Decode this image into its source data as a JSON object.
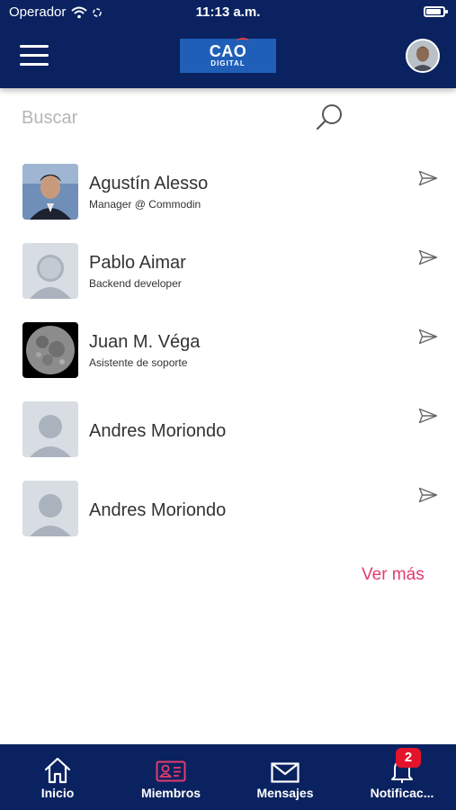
{
  "status_bar": {
    "carrier": "Operador",
    "time": "11:13 a.m.",
    "battery_level": 0.9
  },
  "header": {
    "logo_line1": "CAO",
    "logo_line2": "DIGITAL"
  },
  "search": {
    "placeholder": "Buscar"
  },
  "members": [
    {
      "name": "Agustín Alesso",
      "subtitle": "Manager @ Commodin",
      "avatar": "photo-man"
    },
    {
      "name": "Pablo Aimar",
      "subtitle": "Backend developer",
      "avatar": "placeholder"
    },
    {
      "name": "Juan M. Véga",
      "subtitle": "Asistente de soporte",
      "avatar": "photo-moon"
    },
    {
      "name": "Andres Moriondo",
      "subtitle": "",
      "avatar": "placeholder"
    },
    {
      "name": "Andres Moriondo",
      "subtitle": "",
      "avatar": "placeholder"
    }
  ],
  "more_link": "Ver más",
  "tabs": [
    {
      "label": "Inicio",
      "icon": "home-icon"
    },
    {
      "label": "Miembros",
      "icon": "member-card-icon"
    },
    {
      "label": "Mensajes",
      "icon": "mail-icon"
    },
    {
      "label": "Notificac...",
      "icon": "bell-icon"
    }
  ],
  "notification_badge": "2",
  "colors": {
    "primary": "#0a2260",
    "accent": "#e23c6c",
    "badge": "#e3132b"
  }
}
